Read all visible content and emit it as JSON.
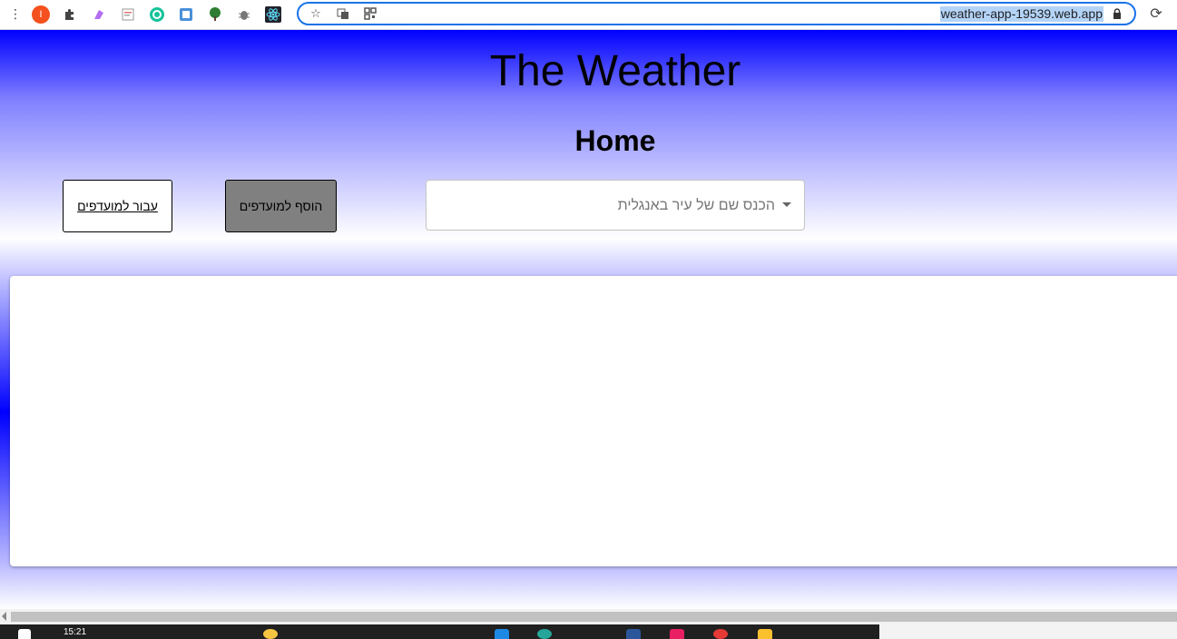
{
  "browser": {
    "url": "weather-app-19539.web.app",
    "extensions": [
      "profile-icon",
      "puzzle-icon",
      "paint-icon",
      "notes-icon",
      "grammarly-icon",
      "ruler-icon",
      "tree-icon",
      "bug-icon",
      "react-icon"
    ],
    "profile_initial": "I"
  },
  "page": {
    "title": "The Weather",
    "subtitle": "Home",
    "go_favorites_label": "עבור למועדפים",
    "add_favorites_label": "הוסף למועדפים",
    "search": {
      "placeholder": "הכנס שם של עיר באנגלית",
      "value": ""
    }
  },
  "taskbar": {
    "clock": "15:21"
  },
  "colors": {
    "gradient_primary": "#0000ff",
    "add_button_bg": "#808080",
    "url_highlight": "#b4d4f7"
  }
}
